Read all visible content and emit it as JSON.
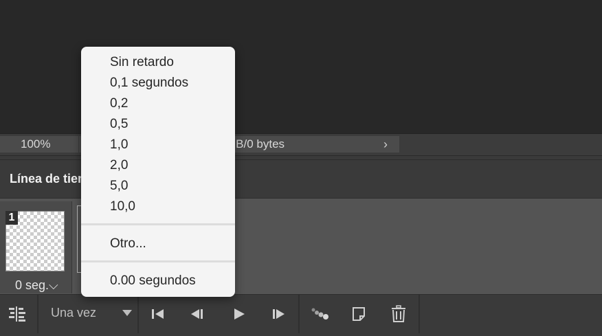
{
  "status": {
    "zoom": "100%",
    "doc_info": "MB/0 bytes",
    "doc_info_arrow": "›"
  },
  "panel": {
    "title": "Línea de tiempo"
  },
  "frames": [
    {
      "number": "1",
      "delay": "0 seg.⌵"
    }
  ],
  "delay_menu": {
    "items": [
      "Sin retardo",
      "0,1 segundos",
      "0,2",
      "0,5",
      "1,0",
      "2,0",
      "5,0",
      "10,0"
    ],
    "other": "Otro...",
    "current": "0.00 segundos"
  },
  "toolbar": {
    "loop_value": "Una vez",
    "icons": [
      "convert-timeline-icon",
      "first-frame-icon",
      "previous-frame-icon",
      "play-icon",
      "next-frame-icon",
      "tween-icon",
      "duplicate-frame-icon",
      "trash-icon"
    ]
  },
  "colors": {
    "canvas": "#282828",
    "panel": "#3a3a3a",
    "menu": "#f4f4f4"
  }
}
